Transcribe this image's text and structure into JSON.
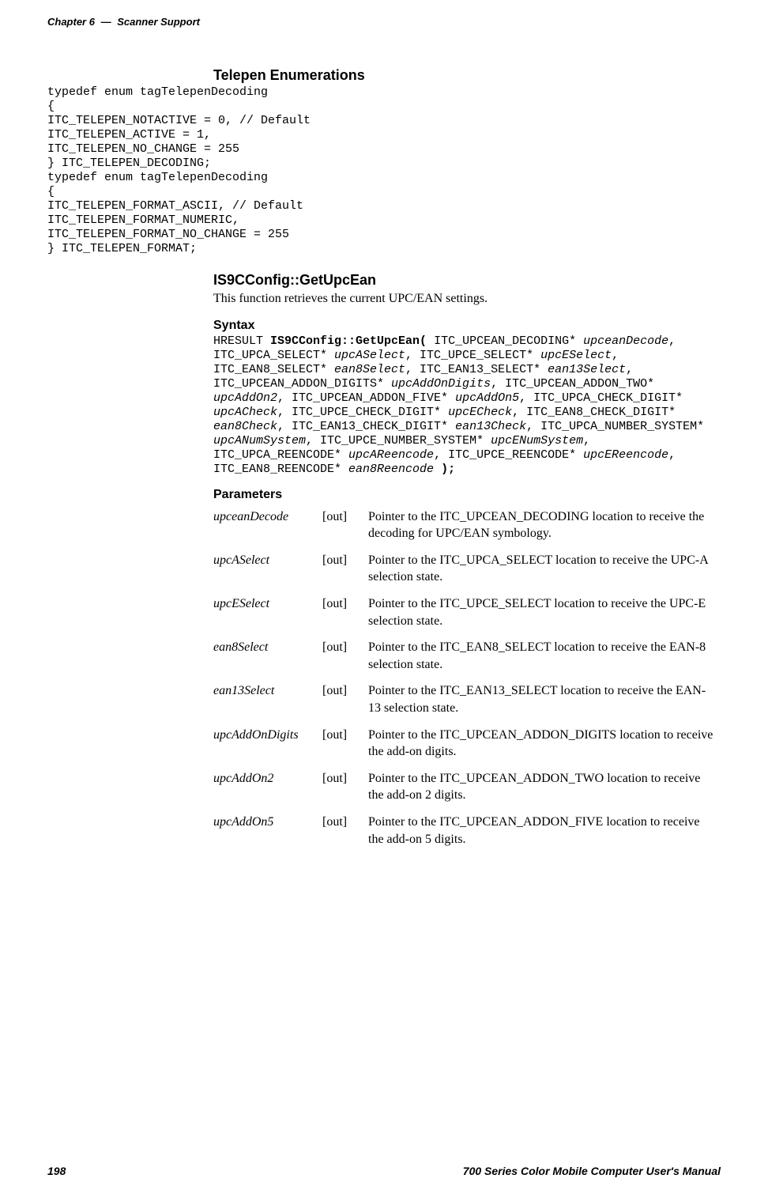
{
  "running_head": {
    "chapter": "Chapter 6",
    "dash": "—",
    "title": "Scanner Support"
  },
  "telepen": {
    "heading": "Telepen Enumerations",
    "code": "typedef enum tagTelepenDecoding\n{\nITC_TELEPEN_NOTACTIVE = 0, // Default\nITC_TELEPEN_ACTIVE = 1,\nITC_TELEPEN_NO_CHANGE = 255\n} ITC_TELEPEN_DECODING;\ntypedef enum tagTelepenDecoding\n{\nITC_TELEPEN_FORMAT_ASCII, // Default\nITC_TELEPEN_FORMAT_NUMERIC,\nITC_TELEPEN_FORMAT_NO_CHANGE = 255\n} ITC_TELEPEN_FORMAT;"
  },
  "getupcean": {
    "heading": "IS9CConfig::GetUpcEan",
    "desc": "This function retrieves the current UPC/EAN settings.",
    "syntax_heading": "Syntax",
    "syn_pre": "HRESULT ",
    "syn_call": "IS9CConfig::GetUpcEan(",
    "syn_t1": " ITC_UPCEAN_DECODING* ",
    "syn_p1": "upceanDecode",
    "syn_t2": ", ITC_UPCA_SELECT* ",
    "syn_p2": "upcASelect",
    "syn_t3": ", ITC_UPCE_SELECT* ",
    "syn_p3": "upcESelect",
    "syn_t4": ", ITC_EAN8_SELECT* ",
    "syn_p4": "ean8Select",
    "syn_t5": ", ITC_EAN13_SELECT* ",
    "syn_p5": "ean13Select",
    "syn_t6": ", ITC_UPCEAN_ADDON_DIGITS* ",
    "syn_p6": "upcAddOnDigits",
    "syn_t7": ", ITC_UPCEAN_ADDON_TWO* ",
    "syn_p7": "upcAddOn2",
    "syn_t8": ", ITC_UPCEAN_ADDON_FIVE* ",
    "syn_p8": "upcAddOn5",
    "syn_t9": ", ITC_UPCA_CHECK_DIGIT* ",
    "syn_p9": "upcACheck",
    "syn_t10": ", ITC_UPCE_CHECK_DIGIT* ",
    "syn_p10": "upcECheck",
    "syn_t11": ", ITC_EAN8_CHECK_DIGIT* ",
    "syn_p11": "ean8Check",
    "syn_t12": ", ITC_EAN13_CHECK_DIGIT* ",
    "syn_p12": "ean13Check",
    "syn_t13": ", ITC_UPCA_NUMBER_SYSTEM* ",
    "syn_p13": "upcANumSystem",
    "syn_t14": ", ITC_UPCE_NUMBER_SYSTEM* ",
    "syn_p14": "upcENumSystem",
    "syn_t15": ", ITC_UPCA_REENCODE* ",
    "syn_p15": "upcAReencode",
    "syn_t16": ", ITC_UPCE_REENCODE* ",
    "syn_p16": "upcEReencode",
    "syn_t17": ", ITC_EAN8_REENCODE* ",
    "syn_p17": "ean8Reencode",
    "syn_end": " );",
    "params_heading": "Parameters",
    "params": [
      {
        "name": "upceanDecode",
        "dir": "[out]",
        "desc": "Pointer to the ITC_UPCEAN_DECODING location to receive the decoding for UPC/EAN symbology."
      },
      {
        "name": "upcASelect",
        "dir": "[out]",
        "desc": "Pointer to the ITC_UPCA_SELECT location to receive the UPC-A selection state."
      },
      {
        "name": "upcESelect",
        "dir": "[out]",
        "desc": "Pointer to the ITC_UPCE_SELECT location to receive the UPC-E selection state."
      },
      {
        "name": "ean8Select",
        "dir": "[out]",
        "desc": "Pointer to the ITC_EAN8_SELECT location to receive the EAN-8 selection state."
      },
      {
        "name": "ean13Select",
        "dir": "[out]",
        "desc": "Pointer to the ITC_EAN13_SELECT location to receive the EAN-13 selection state."
      },
      {
        "name": "upcAddOnDigits",
        "dir": "[out]",
        "desc": "Pointer to the ITC_UPCEAN_ADDON_DIGITS location to receive the add-on digits."
      },
      {
        "name": "upcAddOn2",
        "dir": "[out]",
        "desc": "Pointer to the ITC_UPCEAN_ADDON_TWO location to receive the add-on 2 digits."
      },
      {
        "name": "upcAddOn5",
        "dir": "[out]",
        "desc": "Pointer to the ITC_UPCEAN_ADDON_FIVE location to receive the add-on 5 digits."
      }
    ]
  },
  "footer": {
    "page": "198",
    "title": "700 Series Color Mobile Computer User's Manual"
  }
}
